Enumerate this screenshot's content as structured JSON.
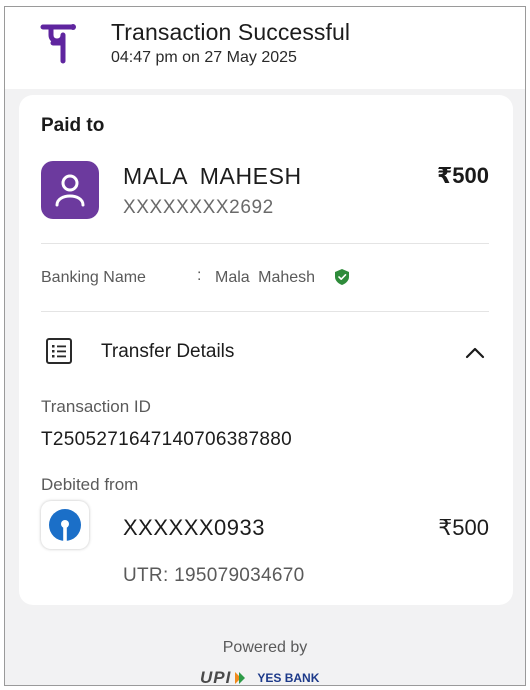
{
  "header": {
    "status_title": "Transaction Successful",
    "timestamp": "04:47 pm on 27 May 2025",
    "brand_color": "#5f259f"
  },
  "payment": {
    "paid_to_label": "Paid to",
    "payee_name": "MALA  MAHESH",
    "payee_account": "XXXXXXXX2692",
    "amount": "₹500",
    "banking_name_label": "Banking Name",
    "banking_name_separator": ":",
    "banking_name_value": "Mala  Mahesh",
    "verified_color": "#2e8b3a"
  },
  "transfer": {
    "section_label": "Transfer Details",
    "transaction_id_label": "Transaction ID",
    "transaction_id": "T2505271647140706387880",
    "debited_from_label": "Debited from",
    "debit_account": "XXXXXX0933",
    "debit_amount": "₹500",
    "utr": "UTR: 195079034670"
  },
  "footer": {
    "powered_by": "Powered by",
    "upi_logo_text": "UPI",
    "partner_bank": "YES BANK"
  }
}
